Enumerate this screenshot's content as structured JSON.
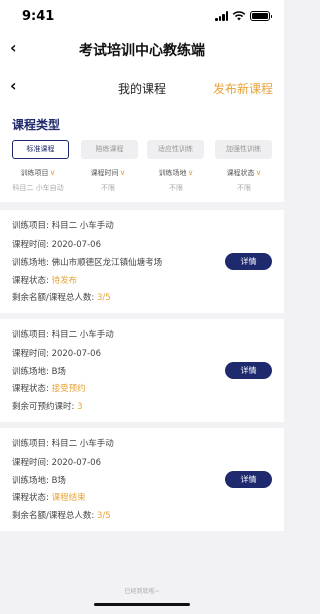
{
  "status_bar": {
    "time": "9:41"
  },
  "header": {
    "back_icon": "chevron-left-icon",
    "title": "考试培训中心教练端"
  },
  "subheader": {
    "title": "我的课程",
    "action": "发布新课程"
  },
  "filter": {
    "heading": "课程类型",
    "types": [
      "标准课程",
      "陪练课程",
      "适应性训练",
      "加强性训练"
    ],
    "active_type": 0,
    "dropdowns": [
      {
        "label": "训练项目",
        "value": "科目二 小车自动"
      },
      {
        "label": "课程时间",
        "value": "不限"
      },
      {
        "label": "训练场地",
        "value": "不限"
      },
      {
        "label": "课程状态",
        "value": "不限"
      }
    ]
  },
  "cards": [
    {
      "lines": [
        {
          "k": "训练项目:",
          "v": "科目二 小车手动"
        },
        {
          "k": "课程时间:",
          "v": "2020-07-06"
        },
        {
          "k": "训练场地:",
          "v": "佛山市顺德区龙江镇仙塘考场"
        },
        {
          "k": "课程状态:",
          "v": "待发布",
          "warn": true
        },
        {
          "k": "剩余名额/课程总人数:",
          "v": "3/5"
        }
      ],
      "button": "详情"
    },
    {
      "lines": [
        {
          "k": "训练项目:",
          "v": "科目二 小车手动"
        },
        {
          "k": "课程时间:",
          "v": "2020-07-06"
        },
        {
          "k": "训练场地:",
          "v": "B场"
        },
        {
          "k": "课程状态:",
          "v": "接受预约",
          "warn": true
        },
        {
          "k": "剩余可预约课时:",
          "v": "3"
        }
      ],
      "button": "详情"
    },
    {
      "lines": [
        {
          "k": "训练项目:",
          "v": "科目二 小车手动"
        },
        {
          "k": "课程时间:",
          "v": "2020-07-06"
        },
        {
          "k": "训练场地:",
          "v": "B场"
        },
        {
          "k": "课程状态:",
          "v": "课程结束",
          "warn": true
        },
        {
          "k": "剩余名额/课程总人数:",
          "v": "3/5"
        }
      ],
      "button": "详情"
    }
  ],
  "footer": {
    "text": "已经到底啦~"
  },
  "colors": {
    "navy": "#1f2a6e",
    "orange": "#e8a33a"
  }
}
